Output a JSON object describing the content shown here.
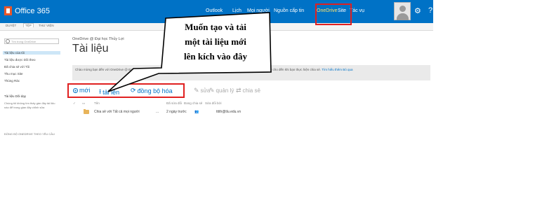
{
  "suite_bar": {
    "brand": "Office 365",
    "nav": [
      "Outlook",
      "Lịch",
      "Mọi người",
      "Nguồn cấp tin",
      "OneDrive",
      "Site",
      "Tác vụ"
    ],
    "settings_icon": "gear-icon",
    "help_label": "?",
    "colors": {
      "bar": "#0072c6",
      "active": "#ffe26a"
    }
  },
  "ribbon": {
    "tabs": [
      "DUYỆT",
      "TỆP",
      "THƯ VIỆN"
    ]
  },
  "left_nav": {
    "search_placeholder": "Tìm trong OneDrive",
    "items": [
      "Tài liệu của tôi",
      "Tài liệu được Dõi theo",
      "Đã chia sẻ với Tôi",
      "Thu mục Site",
      "Thùng Rác"
    ],
    "group_heading": "Tài liệu Dõi dạy",
    "group_desc": "Chúng tôi không tìm thấy gần đây tài liệu nào để trong gian đây chỉnh sửa",
    "sync_text": "ĐỒNG BỘ ONEDRIVE THEO YÊU CẦU"
  },
  "main": {
    "breadcrumb": "OneDrive @ Đại học Thủy Lợi",
    "title": "Tài liệu",
    "notice": "Chào mừng bạn đến với OneDrive @ Đại học Thủy Lợi, nơi lưu trữ, đồng bộ và chia sẻ công việc của bạn. Mọi tài liệu đều ở chế độ riêng tư cho đến khi bạn thực hiện chia sẻ.",
    "notice_link": "Tìm hiểu thêm",
    "notice_dismiss": "Bỏ qua",
    "commands": {
      "new": "mới",
      "upload": "tải lên",
      "sync": "đồng bộ hóa",
      "edit": "sửa",
      "manage": "quản lý",
      "share": "chia sẻ"
    },
    "columns": {
      "name": "Tên",
      "modified": "Đã sửa đổi",
      "sharing": "Đang chia sẻ",
      "modified_by": "Sửa đổi bởi"
    },
    "rows": [
      {
        "name": "Chia sẻ với Tất cả mọi người",
        "more": "...",
        "modified": "2 ngày trước",
        "modified_by": "tttth@tlu.edu.vn"
      }
    ]
  },
  "callout": {
    "line1": "Muốn tạo và tải",
    "line2": "một tài liệu mới",
    "line3": "lên kích vào đây"
  }
}
